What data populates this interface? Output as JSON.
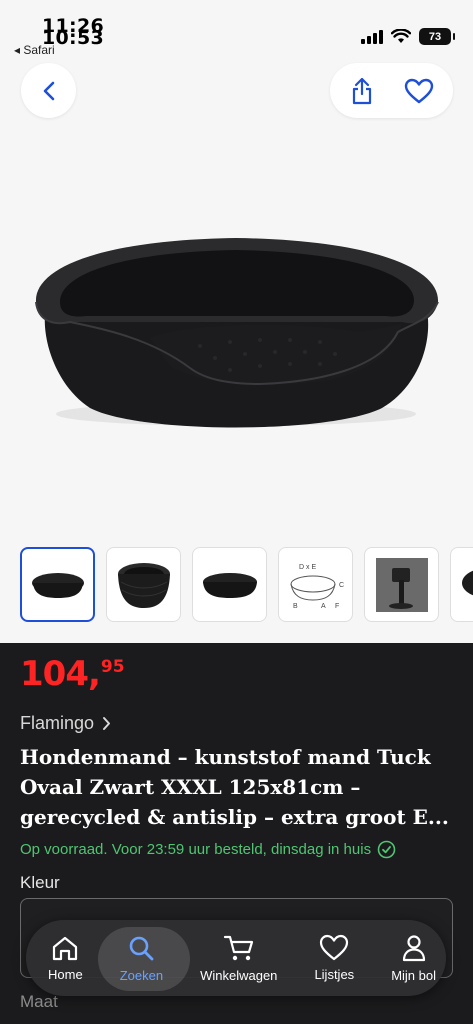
{
  "status": {
    "time_back": "11:26",
    "time_front": "10:53",
    "back_app": "◂ Safari",
    "battery": "73"
  },
  "product": {
    "price_main": "104,",
    "price_cents": "95",
    "brand": "Flamingo",
    "title": "Hondenmand – kunststof mand Tuck Ovaal Zwart XXXL 125x81cm – gerecycled & antislip – extra groot E...",
    "stock": "Op voorraad. Voor 23:59 uur besteld, dinsdag in huis"
  },
  "options": {
    "kleur_label": "Kleur",
    "maat_label": "Maat"
  },
  "nav": {
    "items": [
      {
        "label": "Home",
        "icon": "home-icon"
      },
      {
        "label": "Zoeken",
        "icon": "search-icon"
      },
      {
        "label": "Winkelwagen",
        "icon": "cart-icon"
      },
      {
        "label": "Lijstjes",
        "icon": "heart-icon"
      },
      {
        "label": "Mijn bol",
        "icon": "person-icon"
      }
    ]
  },
  "colors": {
    "accent": "#1e4fd8",
    "price": "#ff2424",
    "stock": "#4fc572",
    "nav_active": "#6aa1ff"
  }
}
